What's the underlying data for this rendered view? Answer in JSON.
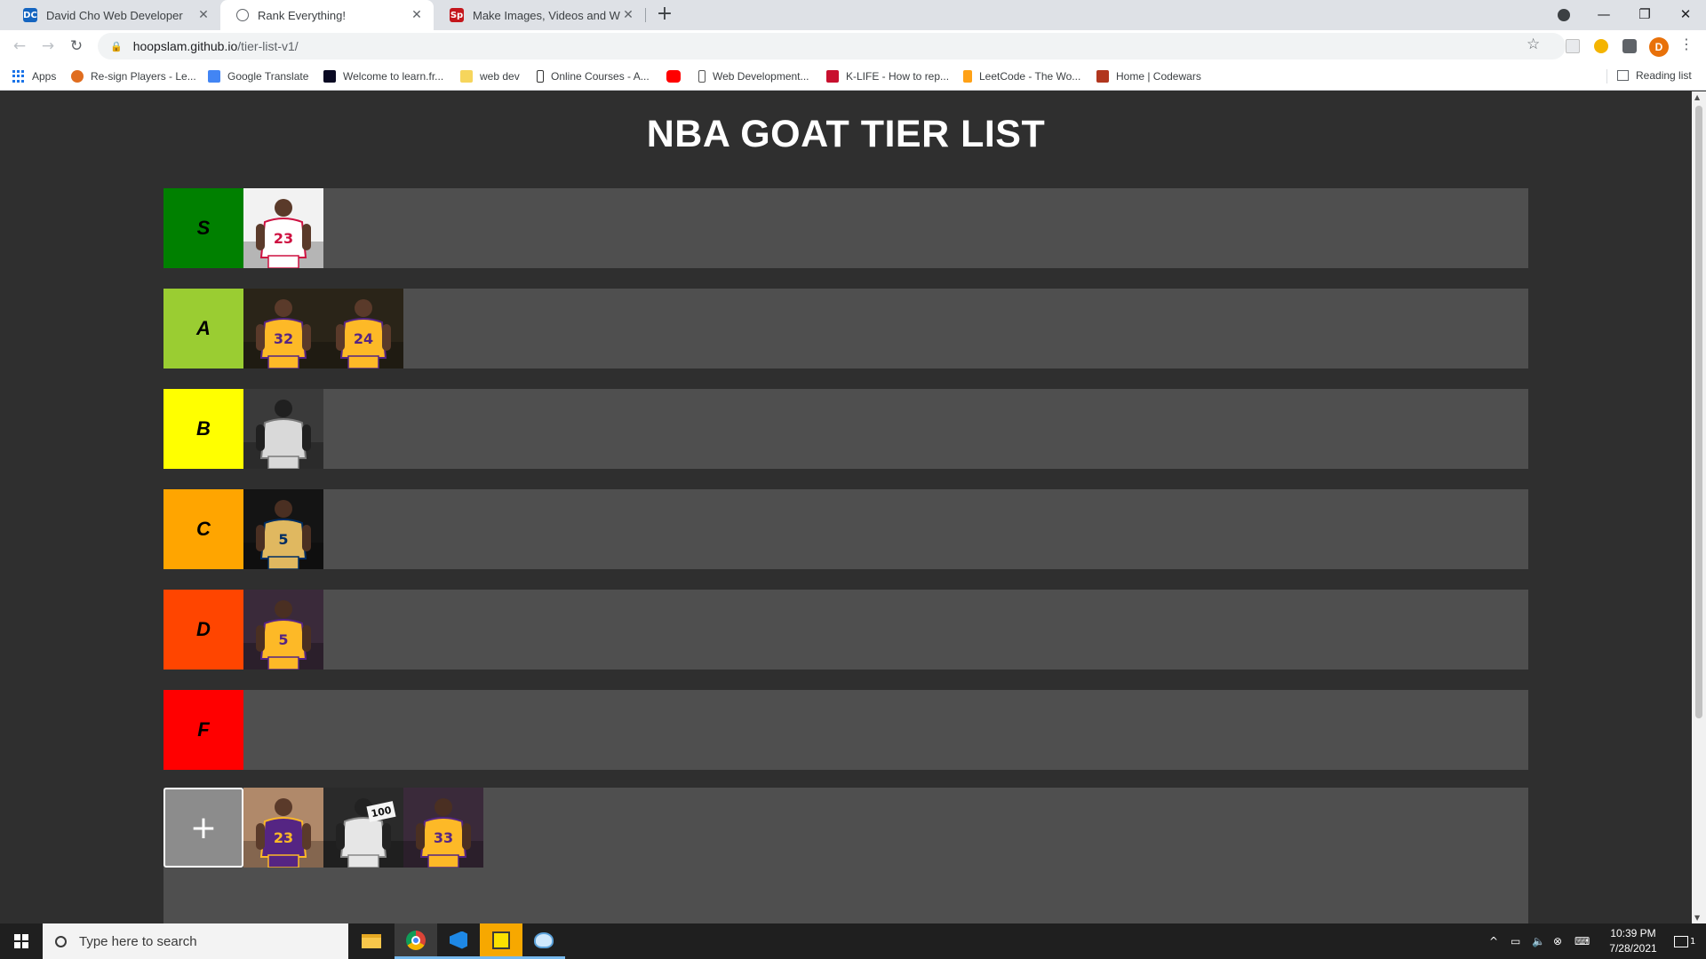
{
  "browser": {
    "tabs": [
      {
        "title": "David Cho Web Developer",
        "active": false,
        "favicon": "dc-logo-icon"
      },
      {
        "title": "Rank Everything!",
        "active": true,
        "favicon": "globe-icon"
      },
      {
        "title": "Make Images, Videos and Web S",
        "active": false,
        "favicon": "adobe-spark-icon"
      }
    ],
    "url": {
      "host": "hoopslam.github.io",
      "path": "/tier-list-v1/"
    },
    "bookmarks": [
      "Apps",
      "Re-sign Players - Le...",
      "Google Translate",
      "Welcome to learn.fr...",
      "web dev",
      "Online Courses - A...",
      "",
      "Web Development...",
      "K-LIFE - How to rep...",
      "LeetCode - The Wo...",
      "Home | Codewars"
    ],
    "reading_list": "Reading list",
    "profile_initial": "D"
  },
  "page": {
    "title": "NBA GOAT TIER LIST",
    "tiers": [
      {
        "label": "S",
        "color": "#008000",
        "cards": [
          {
            "name": "jordan",
            "jersey": "23",
            "team": "bulls"
          }
        ]
      },
      {
        "label": "A",
        "color": "#9acd32",
        "cards": [
          {
            "name": "magic",
            "jersey": "32",
            "team": "lakers"
          },
          {
            "name": "kobe",
            "jersey": "24",
            "team": "lakers"
          }
        ]
      },
      {
        "label": "B",
        "color": "#ffff00",
        "cards": [
          {
            "name": "russell",
            "jersey": "",
            "team": "bw"
          }
        ]
      },
      {
        "label": "C",
        "color": "#ffa500",
        "cards": [
          {
            "name": "pacers-player",
            "jersey": "5",
            "team": "pacers"
          }
        ]
      },
      {
        "label": "D",
        "color": "#ff4500",
        "cards": [
          {
            "name": "lakers-player",
            "jersey": "5",
            "team": "lakers-gold"
          }
        ]
      },
      {
        "label": "F",
        "color": "#ff0000",
        "cards": []
      }
    ],
    "pool": {
      "add_label": "+",
      "cards": [
        {
          "name": "lebron",
          "jersey": "23",
          "team": "lakers-purple"
        },
        {
          "name": "wilt",
          "jersey": "100",
          "team": "bw-sign"
        },
        {
          "name": "kareem",
          "jersey": "33",
          "team": "lakers-gold"
        }
      ]
    }
  },
  "taskbar": {
    "search_placeholder": "Type here to search",
    "time": "10:39 PM",
    "date": "7/28/2021",
    "notification_count": "1"
  }
}
